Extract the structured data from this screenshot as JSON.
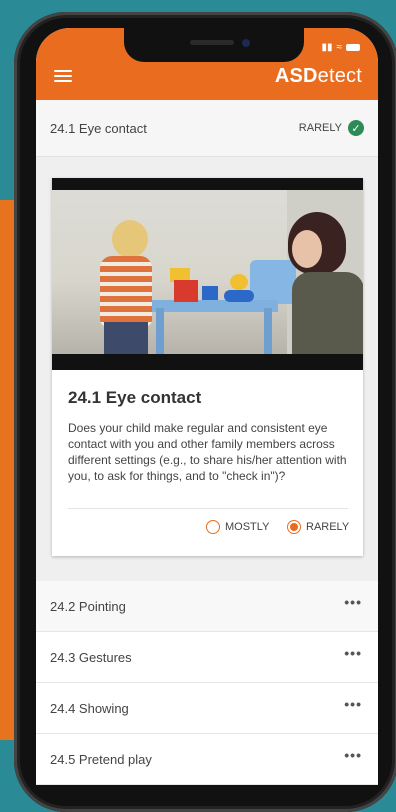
{
  "app": {
    "logo_bold": "ASD",
    "logo_rest": "etect"
  },
  "colors": {
    "accent": "#ea6d1f",
    "check": "#2e8b57"
  },
  "header": {
    "title": "24.1  Eye contact",
    "status": "RARELY",
    "status_icon": "check-circle-icon"
  },
  "card": {
    "title": "24.1  Eye contact",
    "description": "Does your child make regular and consistent eye contact with you and other family members across different settings (e.g., to share his/her attention with you, to ask for things, and to \"check in\")?",
    "options": [
      {
        "label": "MOSTLY",
        "selected": false
      },
      {
        "label": "RARELY",
        "selected": true
      }
    ]
  },
  "list": [
    {
      "label": "24.2  Pointing",
      "more": "•••"
    },
    {
      "label": "24.3  Gestures",
      "more": "•••"
    },
    {
      "label": "24.4  Showing",
      "more": "•••"
    },
    {
      "label": "24.5  Pretend play",
      "more": "•••"
    }
  ]
}
